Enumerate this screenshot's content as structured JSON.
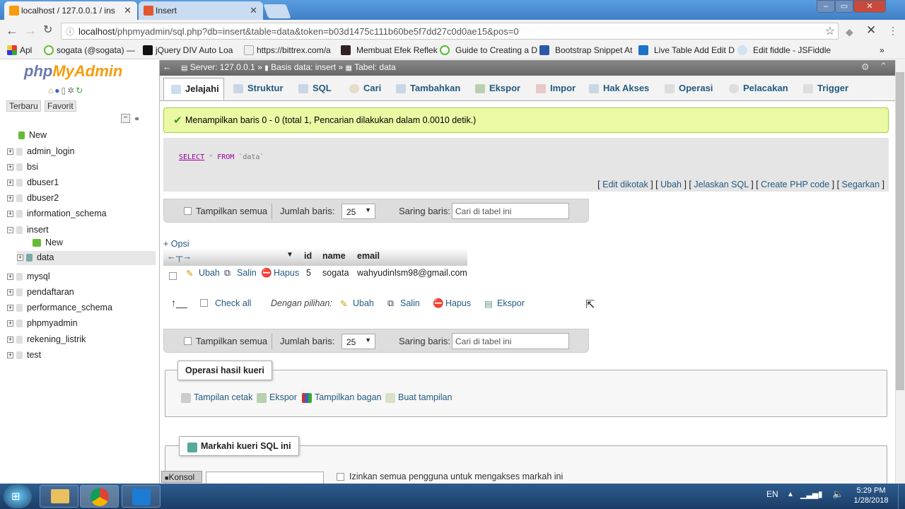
{
  "browser": {
    "tabs": [
      {
        "label": "localhost / 127.0.0.1 / ins",
        "active": true
      },
      {
        "label": "Insert",
        "active": false
      }
    ],
    "url_host": "localhost",
    "url_rest": "/phpmyadmin/sql.php?db=insert&table=data&token=b03d1475c111b60be5f7dd27c0d0ae15&pos=0",
    "bookmarks": [
      {
        "label": "Apl",
        "icon": "apps-grid-icon"
      },
      {
        "label": "sogata (@sogata) —",
        "icon": "twitter-icon"
      },
      {
        "label": "jQuery DIV Auto Loa",
        "icon": "pp-icon"
      },
      {
        "label": "https://bittrex.com/a",
        "icon": "page-icon"
      },
      {
        "label": "Membuat Efek Reflek",
        "icon": "image-icon"
      },
      {
        "label": "Guide to Creating a D",
        "icon": "refresh-icon"
      },
      {
        "label": "Bootstrap Snippet At",
        "icon": "code-icon"
      },
      {
        "label": "Live Table Add Edit D",
        "icon": "w-icon"
      },
      {
        "label": "Edit fiddle - JSFiddle",
        "icon": "cloud-icon"
      }
    ],
    "more": "»"
  },
  "sidebar": {
    "logo_php": "php",
    "logo_my": "MyAdmin",
    "tab_recent": "Terbaru",
    "tab_favorite": "Favorit",
    "tree": [
      {
        "label": "New",
        "type": "new"
      },
      {
        "label": "admin_login",
        "type": "db"
      },
      {
        "label": "bsi",
        "type": "db"
      },
      {
        "label": "dbuser1",
        "type": "db"
      },
      {
        "label": "dbuser2",
        "type": "db"
      },
      {
        "label": "information_schema",
        "type": "db"
      },
      {
        "label": "insert",
        "type": "db-open"
      },
      {
        "label": "New",
        "type": "child-new"
      },
      {
        "label": "data",
        "type": "child-table"
      },
      {
        "label": "mysql",
        "type": "db"
      },
      {
        "label": "pendaftaran",
        "type": "db"
      },
      {
        "label": "performance_schema",
        "type": "db"
      },
      {
        "label": "phpmyadmin",
        "type": "db"
      },
      {
        "label": "rekening_listrik",
        "type": "db"
      },
      {
        "label": "test",
        "type": "db"
      }
    ]
  },
  "breadcrumb": {
    "server": "Server: 127.0.0.1 »",
    "database": "Basis data: insert »",
    "table": "Tabel: data"
  },
  "tabs": [
    {
      "label": "Jelajahi",
      "active": true
    },
    {
      "label": "Struktur"
    },
    {
      "label": "SQL"
    },
    {
      "label": "Cari"
    },
    {
      "label": "Tambahkan"
    },
    {
      "label": "Ekspor"
    },
    {
      "label": "Impor"
    },
    {
      "label": "Hak Akses"
    },
    {
      "label": "Operasi"
    },
    {
      "label": "Pelacakan"
    },
    {
      "label": "Trigger"
    }
  ],
  "message": "Menampilkan baris 0 - 0 (total 1, Pencarian dilakukan dalam 0.0010 detik.)",
  "sql": {
    "select": "SELECT",
    "star": "*",
    "from": "FROM",
    "table": "`data`"
  },
  "sql_links": {
    "edit_inline": "Edit dikotak",
    "edit": "Ubah",
    "explain": "Jelaskan SQL",
    "php": "Create PHP code",
    "refresh": "Segarkan"
  },
  "navbar": {
    "show_all": "Tampilkan semua",
    "rows_label": "Jumlah baris:",
    "rows_value": "25",
    "filter_label": "Saring baris:",
    "filter_placeholder": "Cari di tabel ini"
  },
  "options_link": "+ Opsi",
  "columns": [
    "id",
    "name",
    "email"
  ],
  "rows": [
    {
      "edit": "Ubah",
      "copy": "Salin",
      "delete": "Hapus",
      "id": "5",
      "name": "sogata",
      "email": "wahyudinlsm98@gmail.com"
    }
  ],
  "bulk": {
    "check_all": "Check all",
    "with_selected": "Dengan pilihan:",
    "edit": "Ubah",
    "copy": "Salin",
    "delete": "Hapus",
    "export": "Ekspor"
  },
  "query_ops": {
    "legend": "Operasi hasil kueri",
    "print": "Tampilan cetak",
    "export": "Ekspor",
    "chart": "Tampilkan bagan",
    "view": "Buat tampilan"
  },
  "bookmark_section": {
    "legend": "Markahi kueri SQL ini",
    "share": "Izinkan semua pengguna untuk mengakses markah ini"
  },
  "console": "Konsol",
  "taskbar": {
    "lang": "EN",
    "time": "5:29 PM",
    "date": "1/28/2018"
  },
  "colors": {
    "link": "#235a81",
    "success_bg": "#ebf8a4",
    "chrome_blue": "#3f7fc7"
  }
}
